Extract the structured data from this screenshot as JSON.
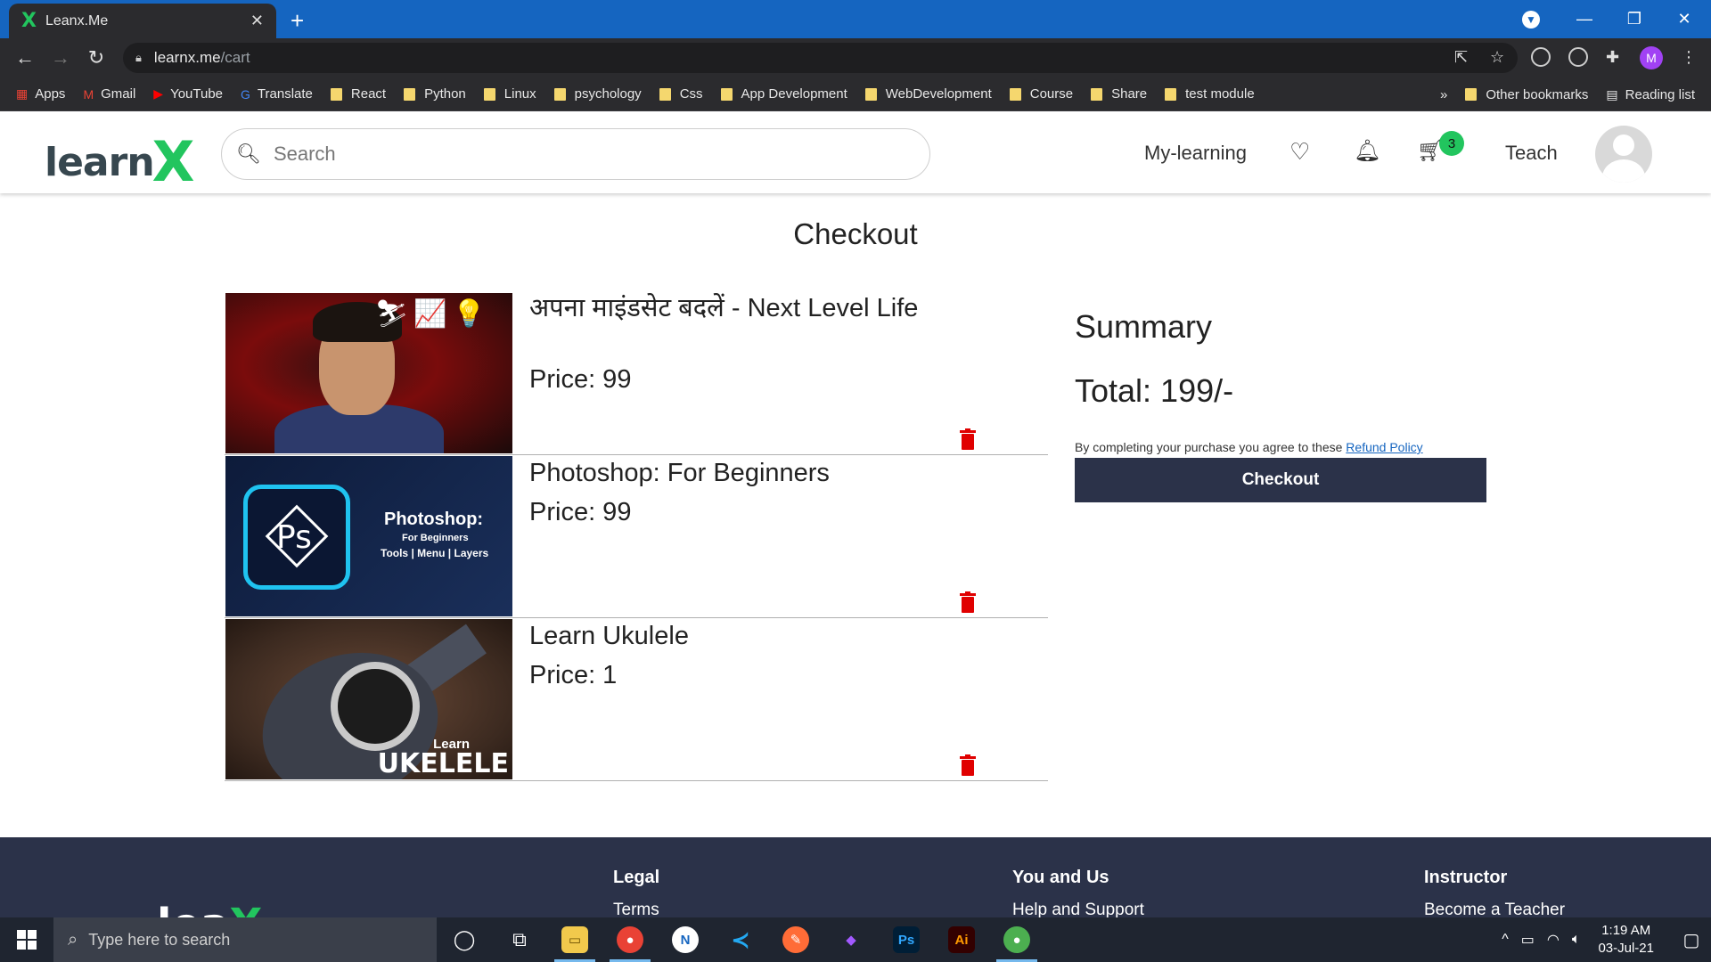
{
  "browser": {
    "tab_title": "Leanx.Me",
    "url_host": "learnx.me",
    "url_path": "/cart",
    "profile_initial": "M",
    "bookmarks": [
      "Apps",
      "Gmail",
      "YouTube",
      "Translate",
      "React",
      "Python",
      "Linux",
      "psychology",
      "Css",
      "App Development",
      "WebDevelopment",
      "Course",
      "Share",
      "test module"
    ],
    "bookmarks_more": "»",
    "other_bookmarks": "Other bookmarks",
    "reading_list": "Reading list"
  },
  "header": {
    "logo_text": "learn",
    "logo_x": "X",
    "search_placeholder": "Search",
    "my_learning": "My-learning",
    "cart_count": "3",
    "teach": "Teach"
  },
  "page": {
    "title": "Checkout"
  },
  "cart": {
    "items": [
      {
        "title": "अपना माइंडसेट बदलें - Next Level Life",
        "price": "Price: 99"
      },
      {
        "title": "Photoshop: For Beginners",
        "price": "Price: 99"
      },
      {
        "title": "Learn Ukulele",
        "price": "Price: 1"
      }
    ]
  },
  "thumbs": {
    "ps_logo": "Ps",
    "ps_title": "Photoshop:",
    "ps_sub": "For Beginners",
    "ps_sub2": "Tools | Menu | Layers",
    "uke_small": "Learn",
    "uke_big": "UKELELE"
  },
  "summary": {
    "title": "Summary",
    "total": "Total: 199/-",
    "agree_text": "By completing your purchase you agree to these ",
    "refund_link": "Refund Policy",
    "checkout_button": "Checkout"
  },
  "footer": {
    "logo_text": "lea",
    "logo_x": "X",
    "columns": [
      {
        "heading": "Legal",
        "link": "Terms"
      },
      {
        "heading": "You and Us",
        "link": "Help and Support"
      },
      {
        "heading": "Instructor",
        "link": "Become a Teacher"
      }
    ]
  },
  "taskbar": {
    "search_placeholder": "Type here to search",
    "time": "1:19 AM",
    "date": "03-Jul-21"
  },
  "colors": {
    "brand_green": "#22c55e",
    "navy": "#2b3249",
    "delete_red": "#e00000",
    "tabstrip_blue": "#1565c0"
  }
}
